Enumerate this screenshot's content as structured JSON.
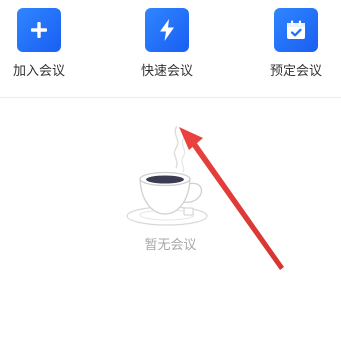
{
  "actions": [
    {
      "id": "join",
      "label": "加入会议",
      "icon": "plus-icon"
    },
    {
      "id": "quick",
      "label": "快速会议",
      "icon": "lightning-icon"
    },
    {
      "id": "schedule",
      "label": "预定会议",
      "icon": "calendar-check-icon"
    }
  ],
  "empty_state": {
    "text": "暂无会议",
    "illustration": "coffee-cup-icon"
  },
  "colors": {
    "accent": "#1f6ff5",
    "annotation": "#e8413e",
    "muted_text": "#a8a8a8"
  }
}
